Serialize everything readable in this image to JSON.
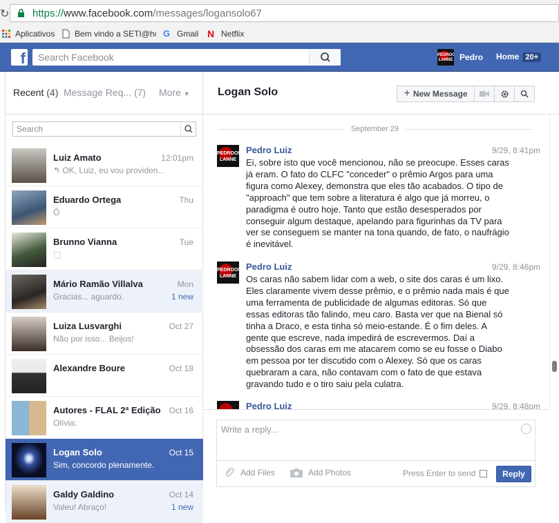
{
  "browser": {
    "url_protocol": "https://",
    "url_host": "www.facebook.com",
    "url_path": "/messages/logansolo67",
    "bookmarks": [
      {
        "label": "Aplicativos",
        "icon": "apps-grid-icon"
      },
      {
        "label": "Bem vindo a SETI@hc",
        "icon": "page-icon"
      },
      {
        "label": "Gmail",
        "icon": "google-g-icon"
      },
      {
        "label": "Netflix",
        "icon": "netflix-n-icon"
      }
    ]
  },
  "fb": {
    "search_placeholder": "Search Facebook",
    "user_name": "Pedro",
    "avatar_text": [
      "PEDROON",
      "LANNE"
    ],
    "home_label": "Home",
    "home_badge": "20+"
  },
  "left": {
    "tab_recent": "Recent",
    "tab_recent_count": "(4)",
    "tab_requests": "Message Req...",
    "tab_requests_count": "(7)",
    "tab_more": "More",
    "search_placeholder": "Search",
    "threads": [
      {
        "name": "Luiz Amato",
        "preview": "↰ OK, Luiz, eu vou providen...",
        "time": "12:01pm",
        "new": "",
        "state": "normal",
        "avatar": "av-amato"
      },
      {
        "name": "Eduardo Ortega",
        "preview": "Ô",
        "time": "Thu",
        "new": "",
        "state": "normal",
        "avatar": "av-ortega"
      },
      {
        "name": "Brunno Vianna",
        "preview": "⬚",
        "time": "Tue",
        "new": "",
        "state": "normal",
        "avatar": "av-vianna"
      },
      {
        "name": "Mário Ramão Villalva",
        "preview": "Gracias... aguardo.",
        "time": "Mon",
        "new": "1 new",
        "state": "unread",
        "avatar": "av-mario"
      },
      {
        "name": "Luiza Lusvarghi",
        "preview": "Não por isso... Beijos!",
        "time": "Oct 27",
        "new": "",
        "state": "normal",
        "avatar": "av-luiza"
      },
      {
        "name": "Alexandre Boure",
        "preview": "",
        "time": "Oct 18",
        "new": "",
        "state": "normal",
        "avatar": "av-boure"
      },
      {
        "name": "Autores - FLAL 2ª Edição",
        "preview": "Olívia:",
        "time": "Oct 16",
        "new": "",
        "state": "normal",
        "avatar": "av-autores"
      },
      {
        "name": "Logan Solo",
        "preview": "Sim, concordo plenamente.",
        "time": "Oct 15",
        "new": "",
        "state": "active",
        "avatar": "av-logan"
      },
      {
        "name": "Galdy Galdino",
        "preview": "Valeu! Abraço!",
        "time": "Oct 14",
        "new": "1 new",
        "state": "unread",
        "avatar": "av-galdy"
      }
    ]
  },
  "convo": {
    "title": "Logan Solo",
    "new_message_label": "New Message",
    "date_separator": "September 29",
    "messages": [
      {
        "author": "Pedro Luiz",
        "time": "9/29, 8:41pm",
        "text": "Ei, sobre isto que você mencionou, não se preocupe. Esses caras já eram. O fato do CLFC \"conceder\" o prêmio Argos para uma figura como Alexey, demonstra que eles tão acabados. O tipo de \"approach\" que tem sobre a literatura é algo que já morreu, o paradigma é outro hoje. Tanto que estão desesperados por conseguir algum destaque, apelando para figurinhas da TV para ver se conseguem se manter na tona quando, de fato, o naufrágio é inevitável."
      },
      {
        "author": "Pedro Luiz",
        "time": "9/29, 8:46pm",
        "text": "Os caras não sabem lidar com a web, o site dos caras é um lixo. Eles claramente vivem desse prêmio, e o prêmio nada mais é que uma ferramenta de publicidade de algumas editoras. Só que essas editoras tão falindo, meu caro. Basta ver que na Bienal só tinha a Draco, e esta tinha só meio-estande. É o fim deles. A gente que escreve, nada impedirá de escrevermos. Daí a obsessão dos caras em me atacarem como se eu fosse o Diabo em pessoa por ter discutido com o Alexey. Só que os caras quebraram a cara, não contavam com o fato de que estava gravando tudo e o tiro saiu pela culatra."
      },
      {
        "author": "Pedro Luiz",
        "time": "9/29, 8:48pm",
        "text": ""
      }
    ],
    "reply_placeholder": "Write a reply...",
    "add_files": "Add Files",
    "add_photos": "Add Photos",
    "press_enter": "Press Enter to send",
    "reply_label": "Reply"
  },
  "colors": {
    "fb_blue": "#4267b2",
    "link_blue": "#365899"
  }
}
